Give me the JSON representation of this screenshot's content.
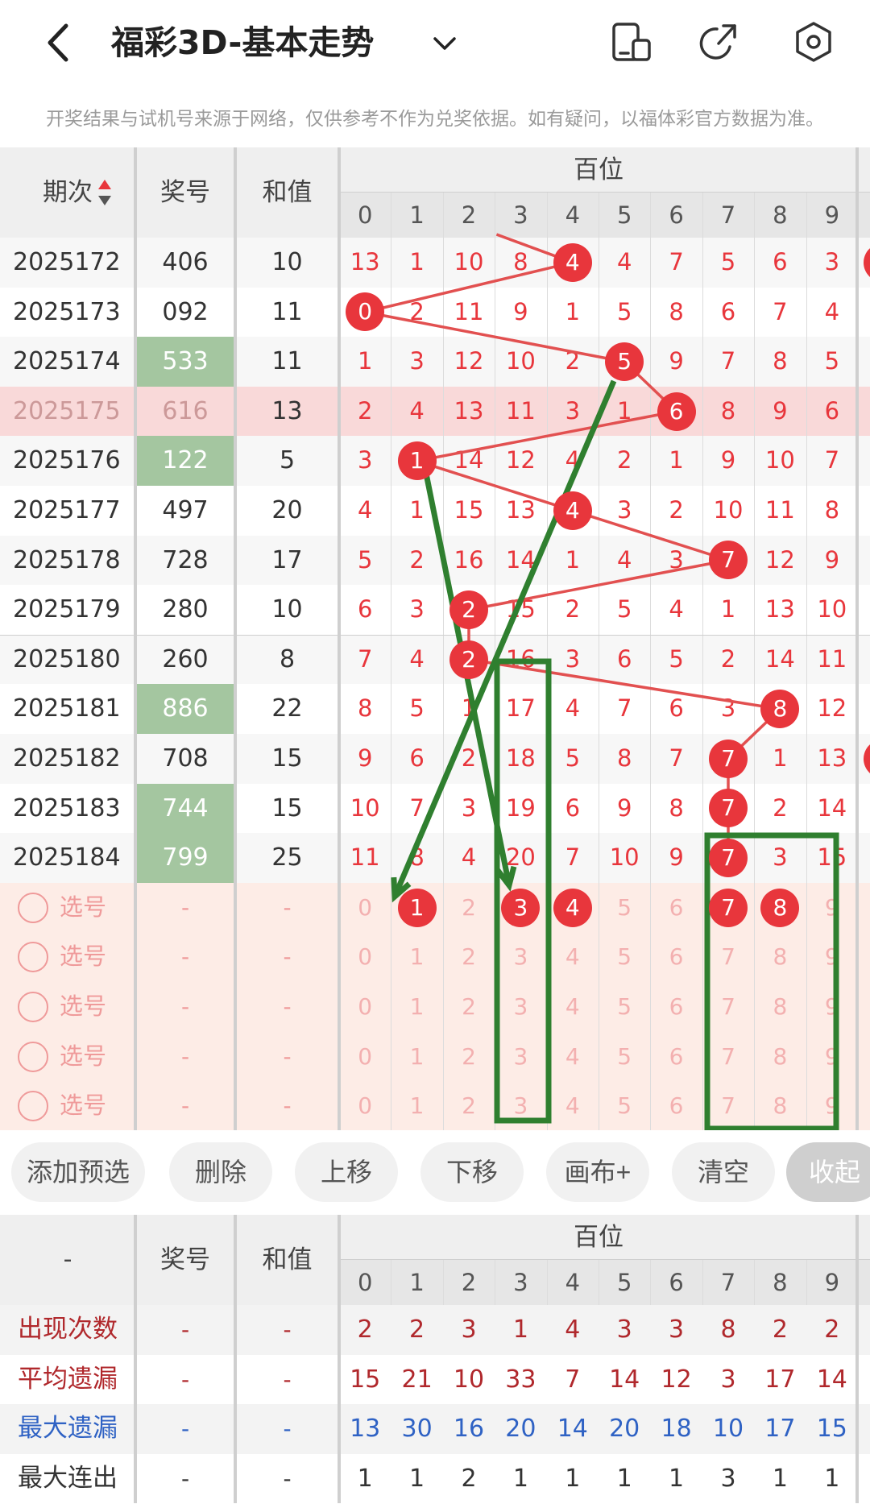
{
  "header": {
    "title": "福彩3D-基本走势",
    "icons": [
      "back-arrow-icon",
      "chevron-down-icon",
      "phone-layout-icon",
      "share-icon",
      "settings-icon"
    ]
  },
  "notice": "开奖结果与试机号来源于网络，仅供参考不作为兑奖依据。如有疑问，以福体彩官方数据为准。",
  "table": {
    "col_headers": {
      "period": "期次",
      "number": "奖号",
      "sum": "和值",
      "group": "百位"
    },
    "digits": [
      "0",
      "1",
      "2",
      "3",
      "4",
      "5",
      "6",
      "7",
      "8",
      "9"
    ],
    "rows": [
      {
        "period": "2025172",
        "number": "406",
        "sum": "10",
        "cells": [
          "13",
          "1",
          "10",
          "8",
          "4",
          "4",
          "7",
          "5",
          "6",
          "3"
        ],
        "hit": 4,
        "highlight": false
      },
      {
        "period": "2025173",
        "number": "092",
        "sum": "11",
        "cells": [
          "0",
          "2",
          "11",
          "9",
          "1",
          "5",
          "8",
          "6",
          "7",
          "4"
        ],
        "hit": 0,
        "highlight": false
      },
      {
        "period": "2025174",
        "number": "533",
        "sum": "11",
        "cells": [
          "1",
          "3",
          "12",
          "10",
          "2",
          "5",
          "9",
          "7",
          "8",
          "5"
        ],
        "hit": 5,
        "highlight": true
      },
      {
        "period": "2025175",
        "number": "616",
        "sum": "13",
        "cells": [
          "2",
          "4",
          "13",
          "11",
          "3",
          "1",
          "6",
          "8",
          "9",
          "6"
        ],
        "hit": 6,
        "highlight": false,
        "selected": true
      },
      {
        "period": "2025176",
        "number": "122",
        "sum": "5",
        "cells": [
          "3",
          "1",
          "14",
          "12",
          "4",
          "2",
          "1",
          "9",
          "10",
          "7"
        ],
        "hit": 1,
        "highlight": true
      },
      {
        "period": "2025177",
        "number": "497",
        "sum": "20",
        "cells": [
          "4",
          "1",
          "15",
          "13",
          "4",
          "3",
          "2",
          "10",
          "11",
          "8"
        ],
        "hit": 4,
        "highlight": false
      },
      {
        "period": "2025178",
        "number": "728",
        "sum": "17",
        "cells": [
          "5",
          "2",
          "16",
          "14",
          "1",
          "4",
          "3",
          "7",
          "12",
          "9"
        ],
        "hit": 7,
        "highlight": false
      },
      {
        "period": "2025179",
        "number": "280",
        "sum": "10",
        "cells": [
          "6",
          "3",
          "2",
          "15",
          "2",
          "5",
          "4",
          "1",
          "13",
          "10"
        ],
        "hit": 2,
        "highlight": false
      },
      {
        "period": "2025180",
        "number": "260",
        "sum": "8",
        "cells": [
          "7",
          "4",
          "2",
          "16",
          "3",
          "6",
          "5",
          "2",
          "14",
          "11"
        ],
        "hit": 2,
        "highlight": false
      },
      {
        "period": "2025181",
        "number": "886",
        "sum": "22",
        "cells": [
          "8",
          "5",
          "1",
          "17",
          "4",
          "7",
          "6",
          "3",
          "8",
          "12"
        ],
        "hit": 8,
        "highlight": true
      },
      {
        "period": "2025182",
        "number": "708",
        "sum": "15",
        "cells": [
          "9",
          "6",
          "2",
          "18",
          "5",
          "8",
          "7",
          "7",
          "1",
          "13"
        ],
        "hit": 7,
        "highlight": false
      },
      {
        "period": "2025183",
        "number": "744",
        "sum": "15",
        "cells": [
          "10",
          "7",
          "3",
          "19",
          "6",
          "9",
          "8",
          "7",
          "2",
          "14"
        ],
        "hit": 7,
        "highlight": true
      },
      {
        "period": "2025184",
        "number": "799",
        "sum": "25",
        "cells": [
          "11",
          "8",
          "4",
          "20",
          "7",
          "10",
          "9",
          "7",
          "3",
          "15"
        ],
        "hit": 7,
        "highlight": true
      }
    ],
    "edge_hits": [
      0,
      10
    ],
    "pick_rows": [
      {
        "label": "选号",
        "number": "-",
        "sum": "-",
        "selected": [
          1,
          3,
          4,
          7,
          8
        ]
      },
      {
        "label": "选号",
        "number": "-",
        "sum": "-",
        "selected": []
      },
      {
        "label": "选号",
        "number": "-",
        "sum": "-",
        "selected": []
      },
      {
        "label": "选号",
        "number": "-",
        "sum": "-",
        "selected": []
      },
      {
        "label": "选号",
        "number": "-",
        "sum": "-",
        "selected": []
      }
    ]
  },
  "toolbar": [
    "添加预选",
    "删除",
    "上移",
    "下移",
    "画布+",
    "清空",
    "收起"
  ],
  "stats": {
    "col_headers": {
      "dash": "-",
      "number": "奖号",
      "sum": "和值",
      "group": "百位"
    },
    "rows": [
      {
        "label": "出现次数",
        "number": "-",
        "sum": "-",
        "values": [
          "2",
          "2",
          "3",
          "1",
          "4",
          "3",
          "3",
          "8",
          "2",
          "2"
        ],
        "color": "#b0282c"
      },
      {
        "label": "平均遗漏",
        "number": "-",
        "sum": "-",
        "values": [
          "15",
          "21",
          "10",
          "33",
          "7",
          "14",
          "12",
          "3",
          "17",
          "14"
        ],
        "color": "#b0282c"
      },
      {
        "label": "最大遗漏",
        "number": "-",
        "sum": "-",
        "values": [
          "13",
          "30",
          "16",
          "20",
          "14",
          "20",
          "18",
          "10",
          "17",
          "15"
        ],
        "color": "#2f62c4"
      },
      {
        "label": "最大连出",
        "number": "-",
        "sum": "-",
        "values": [
          "1",
          "1",
          "2",
          "1",
          "1",
          "1",
          "1",
          "3",
          "1",
          "1"
        ],
        "color": "#333333"
      }
    ]
  },
  "colors": {
    "red": "#e8363c",
    "green": "#2f7f2f",
    "grid": "#d0d0d0",
    "highlight_green": "#a4c6a0",
    "pick_bg": "#fdece6"
  }
}
